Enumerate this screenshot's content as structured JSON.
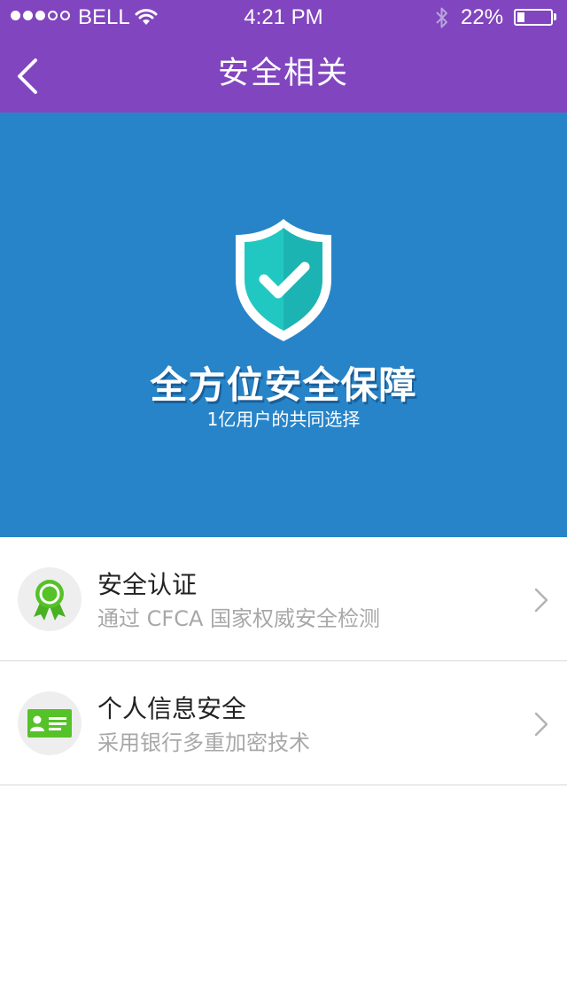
{
  "status_bar": {
    "carrier": "BELL",
    "time": "4:21 PM",
    "battery_percent": "22%",
    "battery_level": 0.22,
    "signal_strength_dots": 3,
    "signal_total_dots": 5
  },
  "nav": {
    "title": "安全相关",
    "back_icon": "chevron-left-icon"
  },
  "hero": {
    "title": "全方位安全保障",
    "subtitle": "1亿用户的共同选择",
    "icon": "shield-check-icon"
  },
  "items": [
    {
      "title": "安全认证",
      "subtitle": "通过 CFCA 国家权威安全检测",
      "icon": "award-ribbon-icon"
    },
    {
      "title": "个人信息安全",
      "subtitle": "采用银行多重加密技术",
      "icon": "id-card-icon"
    }
  ],
  "colors": {
    "nav_background": "#8145bf",
    "hero_background": "#2784c8",
    "icon_green": "#55c228",
    "shield_teal": "#1fc6c1"
  }
}
